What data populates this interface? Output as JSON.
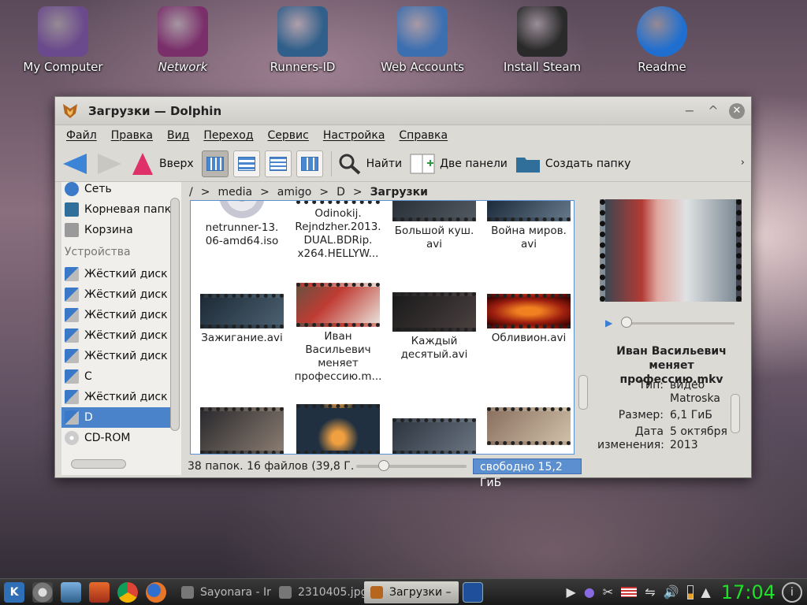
{
  "desktop": {
    "icons": [
      {
        "label": "My Computer",
        "italic": false,
        "color": "#6a4a8c"
      },
      {
        "label": "Network",
        "italic": true,
        "color": "#7a2f6a"
      },
      {
        "label": "Runners-ID",
        "italic": false,
        "color": "#2f5f8a"
      },
      {
        "label": "Web Accounts",
        "italic": false,
        "color": "#3b6fb0"
      },
      {
        "label": "Install Steam",
        "italic": false,
        "color": "#2a2a2a"
      },
      {
        "label": "Readme",
        "italic": false,
        "color": "#1f6fd0"
      }
    ]
  },
  "window": {
    "title": "Загрузки — Dolphin",
    "buttons": {
      "minimize": "−",
      "maximize": "^",
      "close": "✕"
    },
    "menu": [
      "Файл",
      "Правка",
      "Вид",
      "Переход",
      "Сервис",
      "Настройка",
      "Справка"
    ],
    "toolbar": {
      "up_label": "Вверх",
      "find_label": "Найти",
      "split_label": "Две панели",
      "newfolder_label": "Создать папку",
      "more": "›"
    },
    "places": [
      {
        "label": "Сеть",
        "icon": "network-icon",
        "color": "#3a7ac8"
      },
      {
        "label": "Корневая папка",
        "icon": "folder-icon",
        "color": "#2f6f9a"
      },
      {
        "label": "Корзина",
        "icon": "trash-icon",
        "color": "#9a9a9a"
      }
    ],
    "devices_group": "Устройства",
    "devices": [
      {
        "label": "Жёсткий диск (",
        "selected": false
      },
      {
        "label": "Жёсткий диск (",
        "selected": false
      },
      {
        "label": "Жёсткий диск (",
        "selected": false
      },
      {
        "label": "Жёсткий диск (",
        "selected": false
      },
      {
        "label": "Жёсткий диск (",
        "selected": false
      },
      {
        "label": "C",
        "selected": false
      },
      {
        "label": "Жёсткий диск (",
        "selected": false
      },
      {
        "label": "D",
        "selected": true
      },
      {
        "label": "CD-ROM",
        "selected": false
      }
    ],
    "breadcrumb": {
      "root": "/",
      "parts": [
        "media",
        "amigo",
        "D"
      ],
      "current": "Загрузки",
      "sep": ">"
    },
    "files": [
      {
        "name": "netrunner-13.06-amd64.iso",
        "lines": [
          "netrunner-13.",
          "06-amd64.iso"
        ],
        "kind": "disc"
      },
      {
        "name": "Odinokij.Rejndzher.2013.DUAL.BDRip.x264.HELLYW...",
        "lines": [
          "Odinokij.",
          "Rejndzher.2013.",
          "DUAL.BDRip.",
          "x264.HELLYW..."
        ],
        "kind": "video"
      },
      {
        "name": "Большой куш.avi",
        "lines": [
          "Большой куш.",
          "avi"
        ],
        "kind": "video"
      },
      {
        "name": "Война миров.avi",
        "lines": [
          "Война миров.",
          "avi"
        ],
        "kind": "video"
      },
      {
        "name": "Зажигание.avi",
        "lines": [
          "Зажигание.avi"
        ],
        "kind": "video"
      },
      {
        "name": "Иван Васильевич меняет профессию.m...",
        "lines": [
          "Иван",
          "Васильевич",
          "меняет",
          "профессию.m..."
        ],
        "kind": "video"
      },
      {
        "name": "Каждый десятый.avi",
        "lines": [
          "Каждый",
          "десятый.avi"
        ],
        "kind": "video"
      },
      {
        "name": "Обливион.avi",
        "lines": [
          "Обливион.avi"
        ],
        "kind": "video"
      },
      {
        "name": "",
        "lines": [],
        "kind": "video"
      },
      {
        "name": "",
        "lines": [],
        "kind": "video"
      },
      {
        "name": "",
        "lines": [],
        "kind": "video"
      },
      {
        "name": "",
        "lines": [],
        "kind": "video"
      }
    ],
    "status": {
      "summary": "38 папок. 16 файлов (39,8 Г...",
      "free": "свободно 15,2 ГиБ"
    },
    "info_panel": {
      "name_lines": [
        "Иван Васильевич",
        "меняет профессию.mkv"
      ],
      "meta": [
        {
          "key": "Тип:",
          "value": "видео Matroska"
        },
        {
          "key": "Размер:",
          "value": "6,1 ГиБ"
        },
        {
          "key": "Дата изменения:",
          "value": "5 октября 2013"
        }
      ]
    }
  },
  "taskbar": {
    "tasks": [
      {
        "label": "Sayonara - Ir",
        "active": false
      },
      {
        "label": "2310405.jpg",
        "active": false
      },
      {
        "label": "Загрузки –",
        "active": true
      }
    ],
    "clock": "17:04"
  }
}
